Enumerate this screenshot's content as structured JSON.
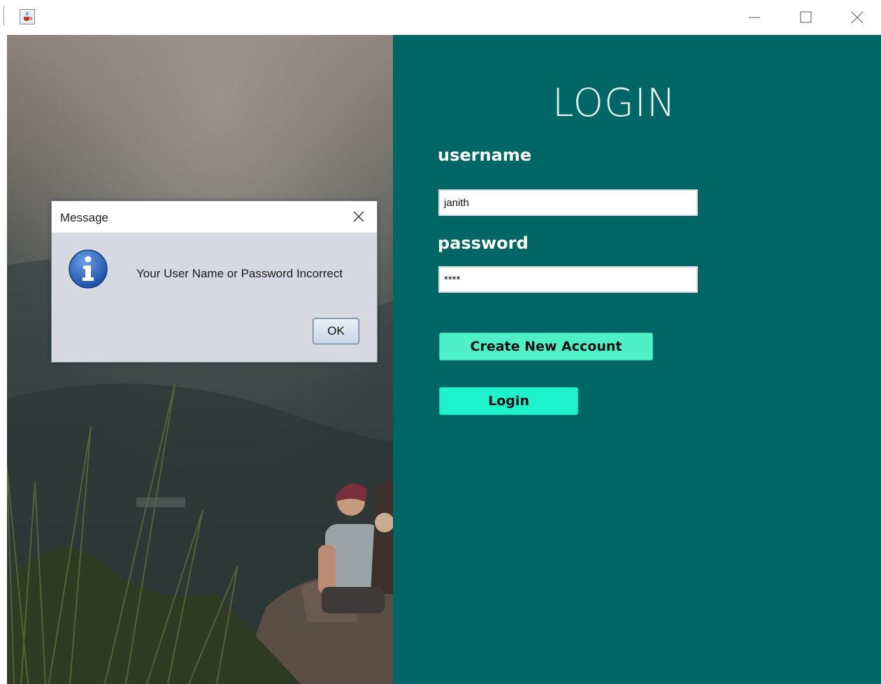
{
  "window": {
    "app_icon": "java-cup-icon",
    "controls": [
      "minimize-icon",
      "maximize-icon",
      "close-icon"
    ]
  },
  "login": {
    "title": "LOGIN",
    "username_label": "username",
    "username_value": "janith",
    "password_label": "password",
    "password_value": "****",
    "create_account_label": "Create New Account",
    "login_label": "Login"
  },
  "dialog": {
    "title": "Message",
    "message": "Your User Name or Password Incorrect",
    "ok_label": "OK",
    "icon": "information-icon"
  },
  "colors": {
    "panel": "#006666",
    "create_button": "#4ff0c8",
    "login_button": "#1df2cc",
    "dialog_body": "#d6d9df"
  }
}
